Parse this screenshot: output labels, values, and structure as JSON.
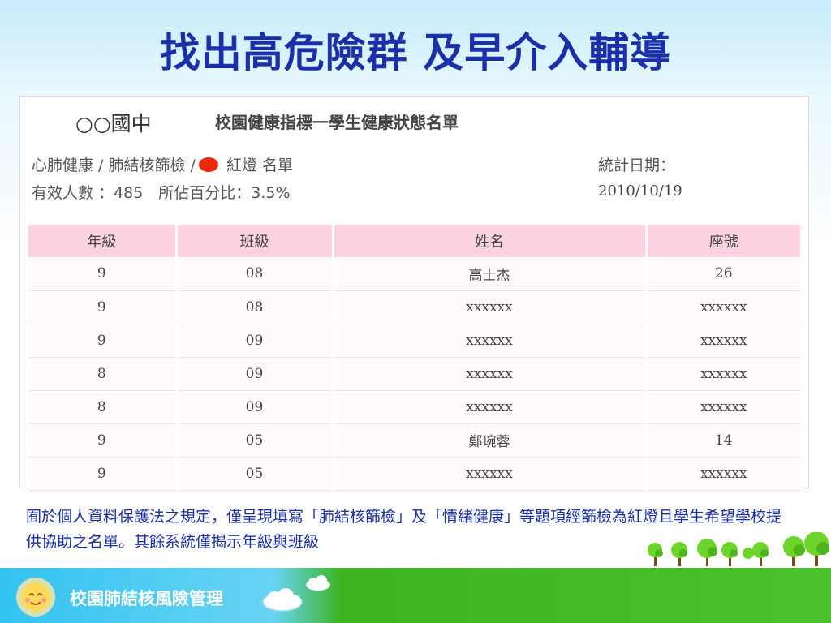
{
  "slide": {
    "title": "找出高危險群 及早介入輔導",
    "note": "囿於個人資料保護法之規定，僅呈現填寫「肺結核篩檢」及「情緒健康」等題項經篩檢為紅燈且學生希望學校提供協助之名單。其餘系統僅揭示年級與班級",
    "footer_label": "校園肺結核風險管理"
  },
  "report": {
    "school": "○○國中",
    "title": "校園健康指標一學生健康狀態名單",
    "filter_before": "心肺健康 / 肺結核篩檢 /",
    "filter_after": "紅燈 名單",
    "count_text": "有效人數 ：485　所佔百分比：3.5%",
    "date_label": "統計日期：",
    "date_value": "2010/10/19"
  },
  "table": {
    "headers": [
      "年級",
      "班級",
      "姓名",
      "座號"
    ],
    "rows": [
      [
        "9",
        "08",
        "高士杰",
        "26"
      ],
      [
        "9",
        "08",
        "xxxxxx",
        "xxxxxx"
      ],
      [
        "9",
        "09",
        "xxxxxx",
        "xxxxxx"
      ],
      [
        "8",
        "09",
        "xxxxxx",
        "xxxxxx"
      ],
      [
        "8",
        "09",
        "xxxxxx",
        "xxxxxx"
      ],
      [
        "9",
        "05",
        "鄭琬蓉",
        "14"
      ],
      [
        "9",
        "05",
        "xxxxxx",
        "xxxxxx"
      ]
    ]
  },
  "colors": {
    "title_blue": "#1a2fa8",
    "header_pink": "#fcd2e0",
    "red_light": "#ee2a0d",
    "footer_blue": "#33c3f0",
    "footer_green": "#4bc12b"
  },
  "icons": [
    "red-light-icon",
    "sun-icon",
    "cloud-icon",
    "tree-icon"
  ]
}
